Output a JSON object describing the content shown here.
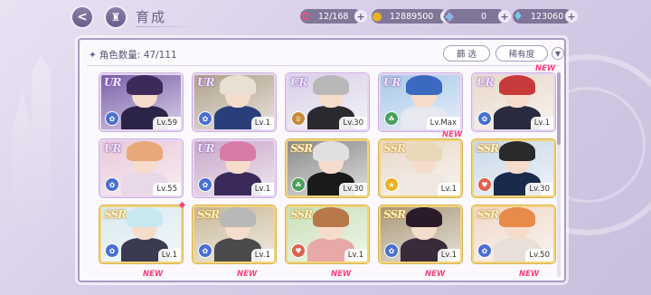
{
  "header": {
    "title": "育成",
    "back_icon": "back-arrow-icon",
    "home_icon": "castle-home-icon"
  },
  "currencies": [
    {
      "name": "stamina",
      "icon": "candy-icon",
      "value": "12/168",
      "color": "#e0557a"
    },
    {
      "name": "gold",
      "icon": "coin-icon",
      "value": "12889500",
      "color": "#e6b422"
    },
    {
      "name": "gem",
      "icon": "diamond-icon",
      "value": "0",
      "color": "#8fb4e8"
    },
    {
      "name": "premium-gem",
      "icon": "crystal-icon",
      "value": "123060",
      "color": "#6fd0e8"
    }
  ],
  "panel": {
    "count_label": "角色数量: 47/111",
    "filter_label": "篩 选",
    "rarity_label": "稀有度",
    "toggle_icon": "chevron-down-icon"
  },
  "cards": [
    {
      "rarity": "UR",
      "level": "Lv.59",
      "hair": "#3b2a5a",
      "body": "#2c2448",
      "bg": "#7a5fa8",
      "attr": "#4a6fd0",
      "attr_icon": "rose-icon",
      "new": false
    },
    {
      "rarity": "UR",
      "level": "Lv.1",
      "hair": "#e8e0d0",
      "body": "#2a3f7a",
      "bg": "#b0a08a",
      "attr": "#4a6fd0",
      "attr_icon": "rose-icon",
      "new": false
    },
    {
      "rarity": "UR",
      "level": "Lv.30",
      "hair": "#b8b8b8",
      "body": "#2a2a30",
      "bg": "#d8d0e8",
      "attr": "#c88a3a",
      "attr_icon": "crown-icon",
      "new": false
    },
    {
      "rarity": "UR",
      "level": "Lv.Max",
      "hair": "#3a6ac0",
      "body": "#e8e8f0",
      "bg": "#a8c8e8",
      "attr": "#4aa05a",
      "attr_icon": "leaf-icon",
      "new": false
    },
    {
      "rarity": "UR",
      "level": "Lv.1",
      "hair": "#c83a3a",
      "body": "#2a2a40",
      "bg": "#e8d8c8",
      "attr": "#4a6fd0",
      "attr_icon": "rose-icon",
      "new": true
    },
    {
      "rarity": "UR",
      "level": "Lv.55",
      "hair": "#e8a878",
      "body": "#e8d8e8",
      "bg": "#e8c8d8",
      "attr": "#4a6fd0",
      "attr_icon": "rose-icon",
      "new": false
    },
    {
      "rarity": "UR",
      "level": "Lv.1",
      "hair": "#d87aa8",
      "body": "#3a2a5a",
      "bg": "#c8a8c8",
      "attr": "#4a6fd0",
      "attr_icon": "rose-icon",
      "new": false
    },
    {
      "rarity": "SSR",
      "level": "Lv.30",
      "hair": "#e0e0e0",
      "body": "#1a1a1a",
      "bg": "#8a8a8a",
      "attr": "#4aa05a",
      "attr_icon": "leaf-icon",
      "new": false
    },
    {
      "rarity": "SSR",
      "level": "Lv.1",
      "hair": "#e8d8b8",
      "body": "#f0e8e0",
      "bg": "#e8d8c8",
      "attr": "#e6b422",
      "attr_icon": "star-icon",
      "new": true
    },
    {
      "rarity": "SSR",
      "level": "Lv.30",
      "hair": "#2a2a2a",
      "body": "#1a2a4a",
      "bg": "#c8d8e8",
      "attr": "#e06050",
      "attr_icon": "heart-icon",
      "new": false
    },
    {
      "rarity": "SSR",
      "level": "Lv.1",
      "hair": "#c8e8f0",
      "body": "#3a3a50",
      "bg": "#d8e8f0",
      "attr": "#4a6fd0",
      "attr_icon": "rose-icon",
      "new": false
    },
    {
      "rarity": "SSR",
      "level": "Lv.1",
      "hair": "#b8b8b8",
      "body": "#4a4a4a",
      "bg": "#c8b898",
      "attr": "#4a6fd0",
      "attr_icon": "rose-icon",
      "new": false
    },
    {
      "rarity": "SSR",
      "level": "Lv.1",
      "hair": "#b8784a",
      "body": "#e8a8a8",
      "bg": "#c8e0b8",
      "attr": "#e06050",
      "attr_icon": "heart-icon",
      "new": false
    },
    {
      "rarity": "SSR",
      "level": "Lv.1",
      "hair": "#2a1a2a",
      "body": "#3a2a3a",
      "bg": "#a89878",
      "attr": "#4a6fd0",
      "attr_icon": "rose-icon",
      "new": false
    },
    {
      "rarity": "SSR",
      "level": "Lv.50",
      "hair": "#e88a4a",
      "body": "#e8e0d8",
      "bg": "#f0d8c8",
      "attr": "#4a6fd0",
      "attr_icon": "rose-icon",
      "new": false
    }
  ],
  "bottom_new_badges": [
    "NEW",
    "NEW",
    "NEW",
    "NEW",
    "NEW"
  ],
  "scroll_position": 0.0
}
